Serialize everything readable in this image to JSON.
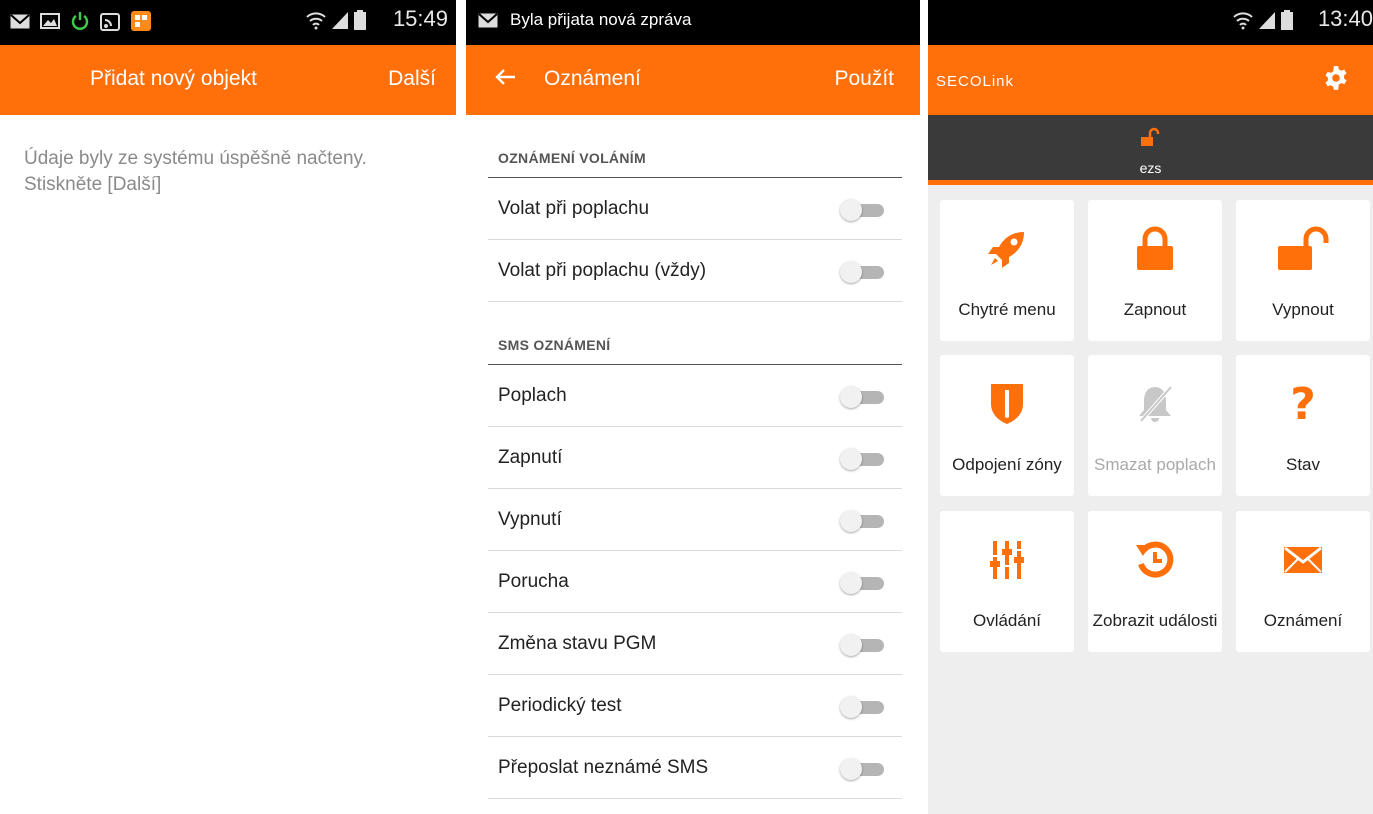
{
  "colors": {
    "accent": "#ff6f0a",
    "dark_bar": "#3a3a3a",
    "status_bar": "#000000"
  },
  "panel1": {
    "status": {
      "time": "15:49",
      "icons": [
        "mail-icon",
        "gallery-icon",
        "power-icon",
        "rss-icon",
        "app-icon",
        "wifi-icon",
        "signal-icon",
        "battery-icon"
      ]
    },
    "appbar": {
      "title": "Přidat nový objekt",
      "action": "Další"
    },
    "message": "Údaje byly ze systému úspěšně načteny. Stiskněte [Další]"
  },
  "panel2": {
    "status": {
      "notification": "Byla přijata nová zpráva",
      "icons": [
        "mail-icon"
      ]
    },
    "appbar": {
      "back_icon": "back-arrow-icon",
      "title": "Oznámení",
      "action": "Použít"
    },
    "sections": [
      {
        "header": "OZNÁMENÍ VOLÁNÍM",
        "items": [
          {
            "label": "Volat při poplachu",
            "enabled": false
          },
          {
            "label": "Volat při poplachu (vždy)",
            "enabled": false
          }
        ]
      },
      {
        "header": "SMS OZNÁMENÍ",
        "items": [
          {
            "label": "Poplach",
            "enabled": false
          },
          {
            "label": "Zapnutí",
            "enabled": false
          },
          {
            "label": "Vypnutí",
            "enabled": false
          },
          {
            "label": "Porucha",
            "enabled": false
          },
          {
            "label": "Změna stavu PGM",
            "enabled": false
          },
          {
            "label": "Periodický test",
            "enabled": false
          },
          {
            "label": "Přeposlat neznámé SMS",
            "enabled": false
          }
        ]
      }
    ]
  },
  "panel3": {
    "status": {
      "time": "13:40",
      "icons": [
        "wifi-icon",
        "signal-icon",
        "battery-icon"
      ]
    },
    "appbar": {
      "logo": "SECOLink",
      "settings_icon": "gear-icon"
    },
    "object": {
      "name": "ezs",
      "icon": "unlocked-icon"
    },
    "tiles": [
      {
        "label": "Chytré menu",
        "icon": "rocket-icon",
        "disabled": false
      },
      {
        "label": "Zapnout",
        "icon": "lock-icon",
        "disabled": false
      },
      {
        "label": "Vypnout",
        "icon": "unlock-icon",
        "disabled": false
      },
      {
        "label": "Odpojení zóny",
        "icon": "shield-icon",
        "disabled": false
      },
      {
        "label": "Smazat poplach",
        "icon": "bell-off-icon",
        "disabled": true
      },
      {
        "label": "Stav",
        "icon": "question-icon",
        "disabled": false
      },
      {
        "label": "Ovládání",
        "icon": "sliders-icon",
        "disabled": false
      },
      {
        "label": "Zobrazit události",
        "icon": "history-icon",
        "disabled": false
      },
      {
        "label": "Oznámení",
        "icon": "envelope-icon",
        "disabled": false
      }
    ]
  }
}
